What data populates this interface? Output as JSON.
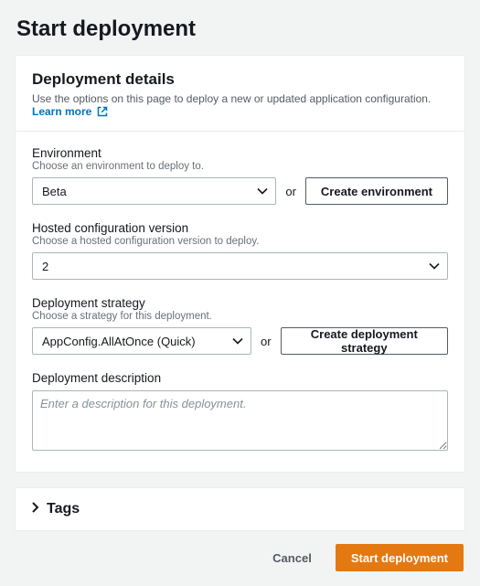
{
  "page": {
    "title": "Start deployment"
  },
  "details": {
    "title": "Deployment details",
    "desc_prefix": "Use the options on this page to deploy a new or updated application configuration.  ",
    "learn_more": "Learn more"
  },
  "fields": {
    "environment": {
      "label": "Environment",
      "desc": "Choose an environment to deploy to.",
      "value": "Beta",
      "or": "or",
      "create_btn": "Create environment"
    },
    "version": {
      "label": "Hosted configuration version",
      "desc": "Choose a hosted configuration version to deploy.",
      "value": "2"
    },
    "strategy": {
      "label": "Deployment strategy",
      "desc": "Choose a strategy for this deployment.",
      "value": "AppConfig.AllAtOnce (Quick)",
      "or": "or",
      "create_btn": "Create deployment strategy"
    },
    "description": {
      "label": "Deployment description",
      "placeholder": "Enter a description for this deployment."
    }
  },
  "tags": {
    "title": "Tags"
  },
  "footer": {
    "cancel": "Cancel",
    "start": "Start deployment"
  }
}
